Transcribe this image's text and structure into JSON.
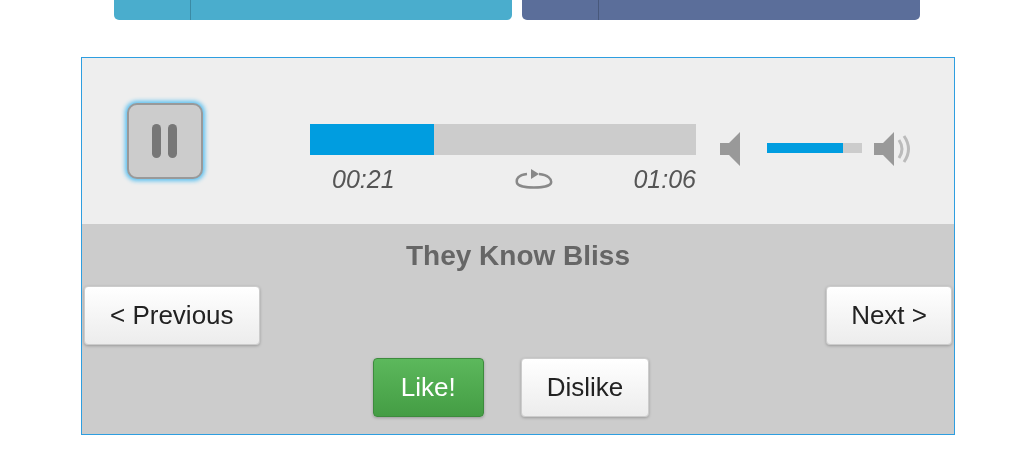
{
  "share_buttons": [
    {
      "color": "#4aadcd"
    },
    {
      "color": "#5b6e9a"
    }
  ],
  "player": {
    "playing": true,
    "progress": {
      "level": 0.32
    },
    "elapsed": "00:21",
    "duration": "01:06",
    "volume": {
      "level": 0.8
    },
    "title": "They Know Bliss",
    "previous": "< Previous",
    "next": "Next >",
    "like": "Like!",
    "dislike": "Dislike"
  }
}
